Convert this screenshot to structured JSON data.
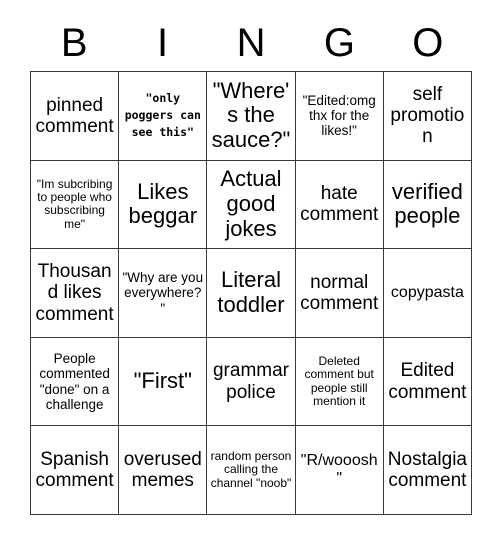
{
  "header": {
    "letters": [
      "B",
      "I",
      "N",
      "G",
      "O"
    ]
  },
  "grid": {
    "columns": 5,
    "rows": 5,
    "border_color": "#3a3a3a",
    "background_color": "#ffffff",
    "text_color": "#000000",
    "cells": [
      {
        "text": "pinned comment",
        "size": "fs-lg",
        "style": "normal"
      },
      {
        "text": "\"only poggers can see this\"",
        "size": "fs-xs",
        "style": "mono"
      },
      {
        "text": "\"Where's the sauce?\"",
        "size": "fs-xl",
        "style": "normal"
      },
      {
        "text": "\"Edited:omg thx for the likes!\"",
        "size": "fs-sm",
        "style": "normal"
      },
      {
        "text": "self promotion",
        "size": "fs-lg",
        "style": "normal"
      },
      {
        "text": "\"Im subcribing to people who subscribing me\"",
        "size": "fs-xs",
        "style": "normal"
      },
      {
        "text": "Likes beggar",
        "size": "fs-xl",
        "style": "normal"
      },
      {
        "text": "Actual good jokes",
        "size": "fs-xl",
        "style": "normal"
      },
      {
        "text": "hate comment",
        "size": "fs-lg",
        "style": "normal"
      },
      {
        "text": "verified people",
        "size": "fs-xl",
        "style": "normal"
      },
      {
        "text": "Thousand likes comment",
        "size": "fs-lg",
        "style": "normal"
      },
      {
        "text": "\"Why are you everywhere?\"",
        "size": "fs-sm",
        "style": "normal"
      },
      {
        "text": "Literal toddler",
        "size": "fs-xl",
        "style": "normal"
      },
      {
        "text": "normal comment",
        "size": "fs-lg",
        "style": "normal"
      },
      {
        "text": "copypasta",
        "size": "fs-md",
        "style": "normal"
      },
      {
        "text": "People commented \"done\" on a challenge",
        "size": "fs-sm",
        "style": "normal"
      },
      {
        "text": "\"First\"",
        "size": "fs-xl",
        "style": "normal"
      },
      {
        "text": "grammar police",
        "size": "fs-lg",
        "style": "normal"
      },
      {
        "text": "Deleted comment but people still mention it",
        "size": "fs-xs",
        "style": "normal"
      },
      {
        "text": "Edited comment",
        "size": "fs-lg",
        "style": "normal"
      },
      {
        "text": "Spanish comment",
        "size": "fs-lg",
        "style": "normal"
      },
      {
        "text": "overused memes",
        "size": "fs-lg",
        "style": "normal"
      },
      {
        "text": "random person calling the channel \"noob\"",
        "size": "fs-xs",
        "style": "normal"
      },
      {
        "text": "\"R/wooosh\"",
        "size": "fs-md",
        "style": "normal"
      },
      {
        "text": "Nostalgia comment",
        "size": "fs-lg",
        "style": "normal"
      }
    ]
  }
}
